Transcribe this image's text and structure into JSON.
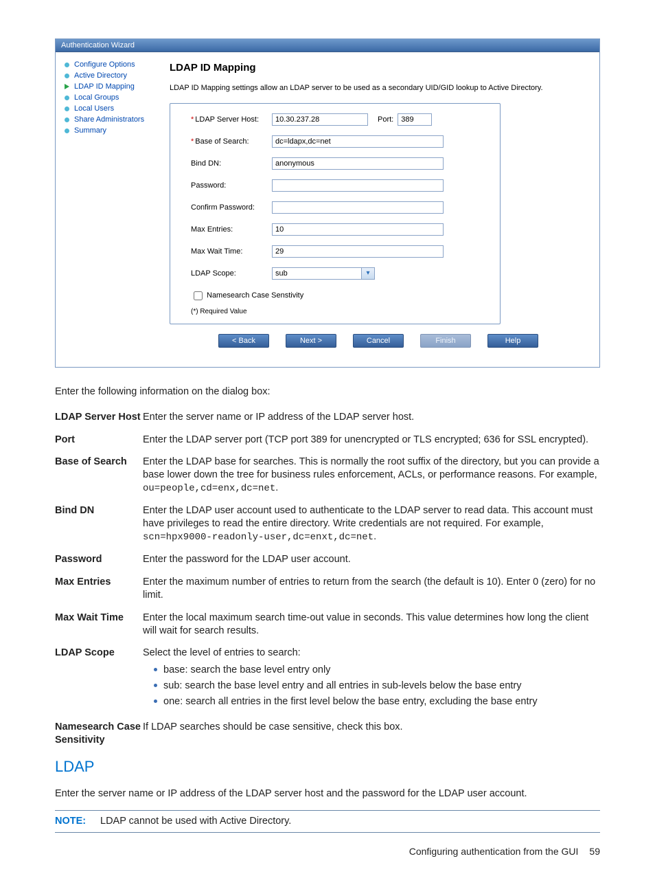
{
  "wizard": {
    "title": "Authentication Wizard",
    "steps": [
      {
        "label": "Configure Options",
        "active": false
      },
      {
        "label": "Active Directory",
        "active": false
      },
      {
        "label": "LDAP ID Mapping",
        "active": true
      },
      {
        "label": "Local Groups",
        "active": false
      },
      {
        "label": "Local Users",
        "active": false
      },
      {
        "label": "Share Administrators",
        "active": false
      },
      {
        "label": "Summary",
        "active": false
      }
    ],
    "heading": "LDAP ID Mapping",
    "description": "LDAP ID Mapping settings allow an LDAP server to be used as a secondary UID/GID lookup to Active Directory.",
    "fields": {
      "ldap_server_host": {
        "label": "LDAP Server Host:",
        "value": "10.30.237.28",
        "required": true
      },
      "port": {
        "label": "Port:",
        "value": "389"
      },
      "base_of_search": {
        "label": "Base of Search:",
        "value": "dc=ldapx,dc=net",
        "required": true
      },
      "bind_dn": {
        "label": "Bind DN:",
        "value": "anonymous"
      },
      "password": {
        "label": "Password:",
        "value": ""
      },
      "confirm_password": {
        "label": "Confirm Password:",
        "value": ""
      },
      "max_entries": {
        "label": "Max Entries:",
        "value": "10"
      },
      "max_wait_time": {
        "label": "Max Wait Time:",
        "value": "29"
      },
      "ldap_scope": {
        "label": "LDAP Scope:",
        "value": "sub"
      },
      "namesearch": {
        "label": "Namesearch Case Senstivity",
        "checked": false
      }
    },
    "required_hint": "(*) Required Value",
    "buttons": {
      "back": "< Back",
      "next": "Next >",
      "cancel": "Cancel",
      "finish": "Finish",
      "help": "Help"
    }
  },
  "doc": {
    "intro": "Enter the following information on the dialog box:",
    "rows": {
      "ldap_server_host": {
        "term": "LDAP Server Host",
        "desc": "Enter the server name or IP address of the LDAP server host."
      },
      "port": {
        "term": "Port",
        "desc": "Enter the LDAP server port (TCP port 389 for unencrypted or TLS encrypted; 636 for SSL encrypted)."
      },
      "base_of_search": {
        "term": "Base of Search",
        "desc_pre": "Enter the LDAP base for searches. This is normally the root suffix of the directory, but you can provide a base lower down the tree for business rules enforcement, ACLs, or performance reasons. For example, ",
        "code": "ou=people,cd=enx,dc=net",
        "desc_post": "."
      },
      "bind_dn": {
        "term": "Bind DN",
        "desc_pre": "Enter the LDAP user account used to authenticate to the LDAP server to read data. This account must have privileges to read the entire directory. Write credentials are not required. For example, ",
        "code": "scn=hpx9000-readonly-user,dc=enxt,dc=net",
        "desc_post": "."
      },
      "password": {
        "term": "Password",
        "desc": "Enter the password for the LDAP user account."
      },
      "max_entries": {
        "term": "Max Entries",
        "desc": "Enter the maximum number of entries to return from the search (the default is 10). Enter 0 (zero) for no limit."
      },
      "max_wait_time": {
        "term": "Max Wait Time",
        "desc": "Enter the local maximum search time-out value in seconds. This value determines how long the client will wait for search results."
      },
      "ldap_scope": {
        "term": "LDAP Scope",
        "desc": "Select the level of entries to search:",
        "items": [
          "base: search the base level entry only",
          "sub: search the base level entry and all entries in sub-levels below the base entry",
          "one: search all entries in the first level below the base entry, excluding the base entry"
        ]
      },
      "namesearch": {
        "term": "Namesearch Case Sensitivity",
        "desc": "If LDAP searches should be case sensitive, check this box."
      }
    },
    "ldap_heading": "LDAP",
    "ldap_para": "Enter the server name or IP address of the LDAP server host and the password for the LDAP user account.",
    "note_tag": "NOTE:",
    "note_text": "LDAP cannot be used with Active Directory.",
    "footer": "Configuring authentication from the GUI",
    "page_number": "59"
  }
}
